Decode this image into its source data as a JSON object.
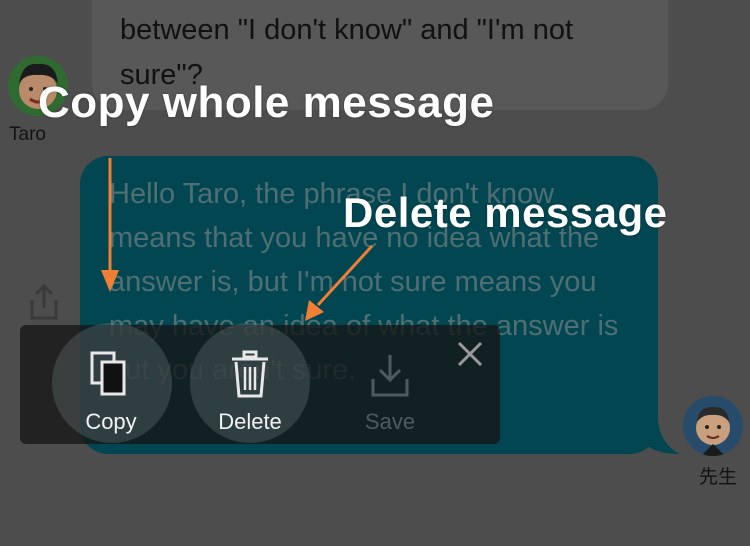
{
  "user_message": {
    "text": "between \"I don't know\" and \"I'm not sure\"?",
    "sender_name": "Taro"
  },
  "teacher_message": {
    "text": "Hello Taro, the phrase I don't know means that you have no idea what the answer is, but I'm not sure means you may have an idea of what the answer is but you aren't sure.",
    "sender_name": "先生"
  },
  "actions": [
    {
      "label": "Copy",
      "icon": "copy-icon"
    },
    {
      "label": "Delete",
      "icon": "trash-icon"
    },
    {
      "label": "Save",
      "icon": "download-icon"
    }
  ],
  "annotations": {
    "copy": "Copy whole message",
    "delete": "Delete message",
    "arrow_color": "#f07f33"
  }
}
